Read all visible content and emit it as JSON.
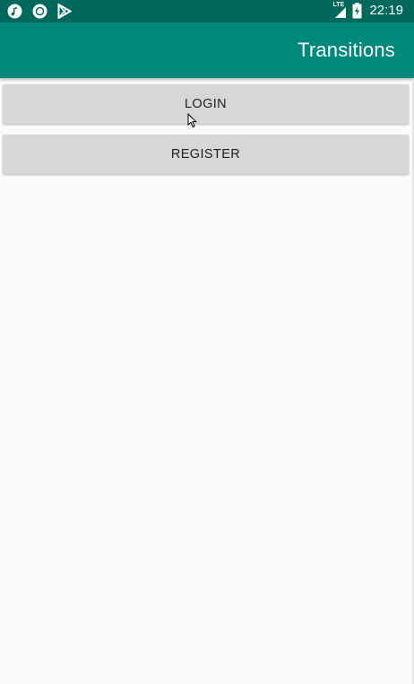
{
  "status_bar": {
    "time": "22:19",
    "network_label": "LTE",
    "icons": [
      "music-note-icon",
      "record-icon",
      "play-store-icon",
      "signal-icon",
      "battery-charging-icon"
    ]
  },
  "app_bar": {
    "title": "Transitions"
  },
  "buttons": {
    "login_label": "LOGIN",
    "register_label": "REGISTER"
  },
  "colors": {
    "status_bar": "#00695c",
    "app_bar": "#00897b",
    "button_bg": "#d6d7d7",
    "page_bg": "#fafafa"
  }
}
